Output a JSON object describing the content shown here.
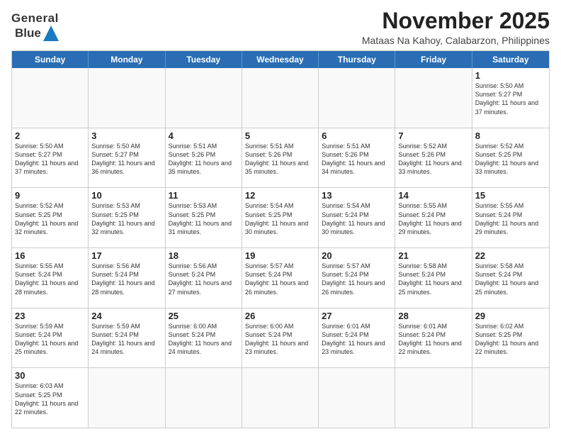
{
  "header": {
    "logo_line1": "General",
    "logo_line2": "Blue",
    "month_title": "November 2025",
    "location": "Mataas Na Kahoy, Calabarzon, Philippines"
  },
  "day_headers": [
    "Sunday",
    "Monday",
    "Tuesday",
    "Wednesday",
    "Thursday",
    "Friday",
    "Saturday"
  ],
  "weeks": [
    [
      {
        "day": "",
        "empty": true
      },
      {
        "day": "",
        "empty": true
      },
      {
        "day": "",
        "empty": true
      },
      {
        "day": "",
        "empty": true
      },
      {
        "day": "",
        "empty": true
      },
      {
        "day": "",
        "empty": true
      },
      {
        "day": "1",
        "sunrise": "Sunrise: 5:50 AM",
        "sunset": "Sunset: 5:27 PM",
        "daylight": "Daylight: 11 hours and 37 minutes."
      }
    ],
    [
      {
        "day": "2",
        "sunrise": "Sunrise: 5:50 AM",
        "sunset": "Sunset: 5:27 PM",
        "daylight": "Daylight: 11 hours and 37 minutes."
      },
      {
        "day": "3",
        "sunrise": "Sunrise: 5:50 AM",
        "sunset": "Sunset: 5:27 PM",
        "daylight": "Daylight: 11 hours and 36 minutes."
      },
      {
        "day": "4",
        "sunrise": "Sunrise: 5:51 AM",
        "sunset": "Sunset: 5:26 PM",
        "daylight": "Daylight: 11 hours and 35 minutes."
      },
      {
        "day": "5",
        "sunrise": "Sunrise: 5:51 AM",
        "sunset": "Sunset: 5:26 PM",
        "daylight": "Daylight: 11 hours and 35 minutes."
      },
      {
        "day": "6",
        "sunrise": "Sunrise: 5:51 AM",
        "sunset": "Sunset: 5:26 PM",
        "daylight": "Daylight: 11 hours and 34 minutes."
      },
      {
        "day": "7",
        "sunrise": "Sunrise: 5:52 AM",
        "sunset": "Sunset: 5:26 PM",
        "daylight": "Daylight: 11 hours and 33 minutes."
      },
      {
        "day": "8",
        "sunrise": "Sunrise: 5:52 AM",
        "sunset": "Sunset: 5:25 PM",
        "daylight": "Daylight: 11 hours and 33 minutes."
      }
    ],
    [
      {
        "day": "9",
        "sunrise": "Sunrise: 5:52 AM",
        "sunset": "Sunset: 5:25 PM",
        "daylight": "Daylight: 11 hours and 32 minutes."
      },
      {
        "day": "10",
        "sunrise": "Sunrise: 5:53 AM",
        "sunset": "Sunset: 5:25 PM",
        "daylight": "Daylight: 11 hours and 32 minutes."
      },
      {
        "day": "11",
        "sunrise": "Sunrise: 5:53 AM",
        "sunset": "Sunset: 5:25 PM",
        "daylight": "Daylight: 11 hours and 31 minutes."
      },
      {
        "day": "12",
        "sunrise": "Sunrise: 5:54 AM",
        "sunset": "Sunset: 5:25 PM",
        "daylight": "Daylight: 11 hours and 30 minutes."
      },
      {
        "day": "13",
        "sunrise": "Sunrise: 5:54 AM",
        "sunset": "Sunset: 5:24 PM",
        "daylight": "Daylight: 11 hours and 30 minutes."
      },
      {
        "day": "14",
        "sunrise": "Sunrise: 5:55 AM",
        "sunset": "Sunset: 5:24 PM",
        "daylight": "Daylight: 11 hours and 29 minutes."
      },
      {
        "day": "15",
        "sunrise": "Sunrise: 5:55 AM",
        "sunset": "Sunset: 5:24 PM",
        "daylight": "Daylight: 11 hours and 29 minutes."
      }
    ],
    [
      {
        "day": "16",
        "sunrise": "Sunrise: 5:55 AM",
        "sunset": "Sunset: 5:24 PM",
        "daylight": "Daylight: 11 hours and 28 minutes."
      },
      {
        "day": "17",
        "sunrise": "Sunrise: 5:56 AM",
        "sunset": "Sunset: 5:24 PM",
        "daylight": "Daylight: 11 hours and 28 minutes."
      },
      {
        "day": "18",
        "sunrise": "Sunrise: 5:56 AM",
        "sunset": "Sunset: 5:24 PM",
        "daylight": "Daylight: 11 hours and 27 minutes."
      },
      {
        "day": "19",
        "sunrise": "Sunrise: 5:57 AM",
        "sunset": "Sunset: 5:24 PM",
        "daylight": "Daylight: 11 hours and 26 minutes."
      },
      {
        "day": "20",
        "sunrise": "Sunrise: 5:57 AM",
        "sunset": "Sunset: 5:24 PM",
        "daylight": "Daylight: 11 hours and 26 minutes."
      },
      {
        "day": "21",
        "sunrise": "Sunrise: 5:58 AM",
        "sunset": "Sunset: 5:24 PM",
        "daylight": "Daylight: 11 hours and 25 minutes."
      },
      {
        "day": "22",
        "sunrise": "Sunrise: 5:58 AM",
        "sunset": "Sunset: 5:24 PM",
        "daylight": "Daylight: 11 hours and 25 minutes."
      }
    ],
    [
      {
        "day": "23",
        "sunrise": "Sunrise: 5:59 AM",
        "sunset": "Sunset: 5:24 PM",
        "daylight": "Daylight: 11 hours and 25 minutes."
      },
      {
        "day": "24",
        "sunrise": "Sunrise: 5:59 AM",
        "sunset": "Sunset: 5:24 PM",
        "daylight": "Daylight: 11 hours and 24 minutes."
      },
      {
        "day": "25",
        "sunrise": "Sunrise: 6:00 AM",
        "sunset": "Sunset: 5:24 PM",
        "daylight": "Daylight: 11 hours and 24 minutes."
      },
      {
        "day": "26",
        "sunrise": "Sunrise: 6:00 AM",
        "sunset": "Sunset: 5:24 PM",
        "daylight": "Daylight: 11 hours and 23 minutes."
      },
      {
        "day": "27",
        "sunrise": "Sunrise: 6:01 AM",
        "sunset": "Sunset: 5:24 PM",
        "daylight": "Daylight: 11 hours and 23 minutes."
      },
      {
        "day": "28",
        "sunrise": "Sunrise: 6:01 AM",
        "sunset": "Sunset: 5:24 PM",
        "daylight": "Daylight: 11 hours and 22 minutes."
      },
      {
        "day": "29",
        "sunrise": "Sunrise: 6:02 AM",
        "sunset": "Sunset: 5:25 PM",
        "daylight": "Daylight: 11 hours and 22 minutes."
      }
    ],
    [
      {
        "day": "30",
        "sunrise": "Sunrise: 6:03 AM",
        "sunset": "Sunset: 5:25 PM",
        "daylight": "Daylight: 11 hours and 22 minutes."
      },
      {
        "day": "",
        "empty": true
      },
      {
        "day": "",
        "empty": true
      },
      {
        "day": "",
        "empty": true
      },
      {
        "day": "",
        "empty": true
      },
      {
        "day": "",
        "empty": true
      },
      {
        "day": "",
        "empty": true
      }
    ]
  ]
}
